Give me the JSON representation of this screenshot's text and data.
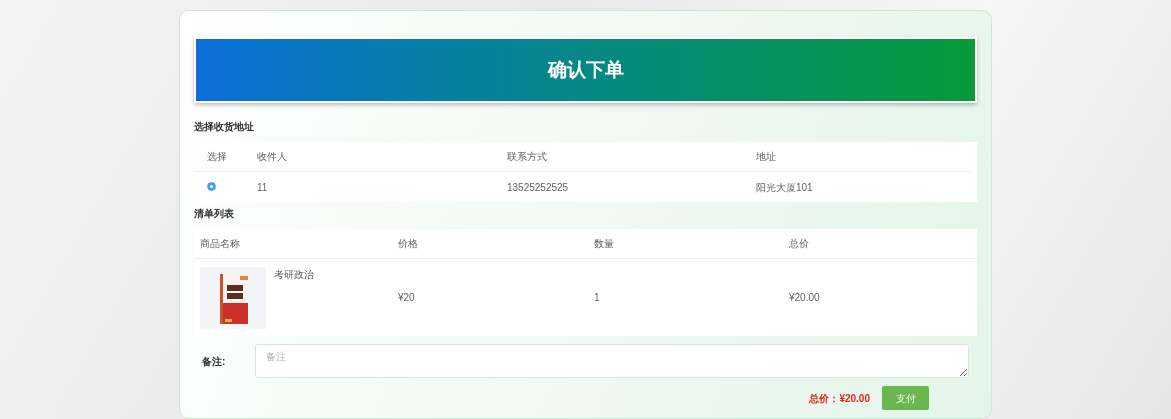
{
  "header": {
    "title": "确认下单"
  },
  "address_section": {
    "title": "选择收货地址",
    "columns": [
      "选择",
      "收件人",
      "联系方式",
      "地址"
    ],
    "rows": [
      {
        "selected": true,
        "recipient": "11",
        "phone": "13525252525",
        "address": "阳光大厦101"
      }
    ]
  },
  "items_section": {
    "title": "清单列表",
    "columns": [
      "商品名称",
      "价格",
      "数量",
      "总价"
    ],
    "rows": [
      {
        "name": "考研政治",
        "price": "¥20",
        "quantity": "1",
        "total": "¥20.00"
      }
    ]
  },
  "remark": {
    "label": "备注:",
    "placeholder": "备注"
  },
  "footer": {
    "total_label": "总价：",
    "total_value": "¥20.00",
    "pay_button": "支付"
  }
}
